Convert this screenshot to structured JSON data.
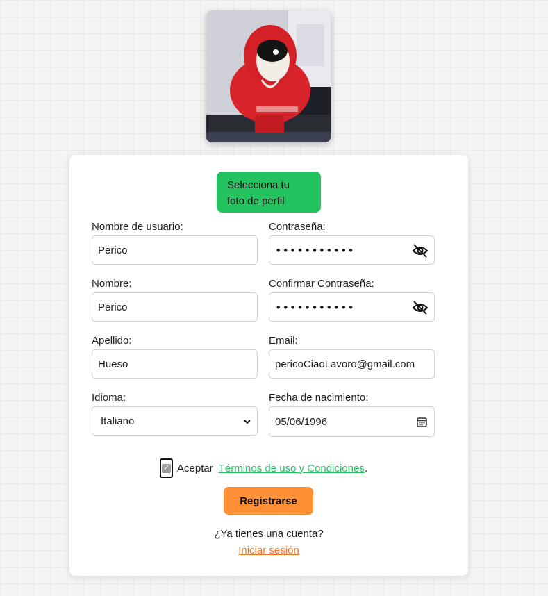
{
  "avatar": {
    "alt": "Foto de perfil"
  },
  "photo_button": {
    "line1": "Selecciona tu",
    "line2": "foto de perfil"
  },
  "fields": {
    "username": {
      "label": "Nombre de usuario:",
      "value": "Perico"
    },
    "password": {
      "label": "Contraseña:",
      "value": "•••••••••••"
    },
    "first_name": {
      "label": "Nombre:",
      "value": "Perico"
    },
    "confirm_password": {
      "label": "Confirmar Contraseña:",
      "value": "•••••••••••"
    },
    "last_name": {
      "label": "Apellido:",
      "value": "Hueso"
    },
    "email": {
      "label": "Email:",
      "value": "pericoCiaoLavoro@gmail.com"
    },
    "language": {
      "label": "Idioma:",
      "value": "Italiano"
    },
    "birthdate": {
      "label": "Fecha de nacimiento:",
      "value": "05/06/1996"
    }
  },
  "terms": {
    "checked": true,
    "prefix": "Aceptar",
    "link": "Términos de uso y Condiciones",
    "suffix": "."
  },
  "register_button": "Registrarse",
  "account_question": "¿Ya tienes una cuenta?",
  "login_link": "Iniciar sesión",
  "colors": {
    "photo_button": "#22c35e",
    "register_button": "#ff9035",
    "terms_link": "#22c35e",
    "login_link": "#f0741f"
  },
  "icons": {
    "password_toggle": "eye-slash-icon",
    "select": "chevron-down-icon",
    "date": "calendar-icon"
  }
}
